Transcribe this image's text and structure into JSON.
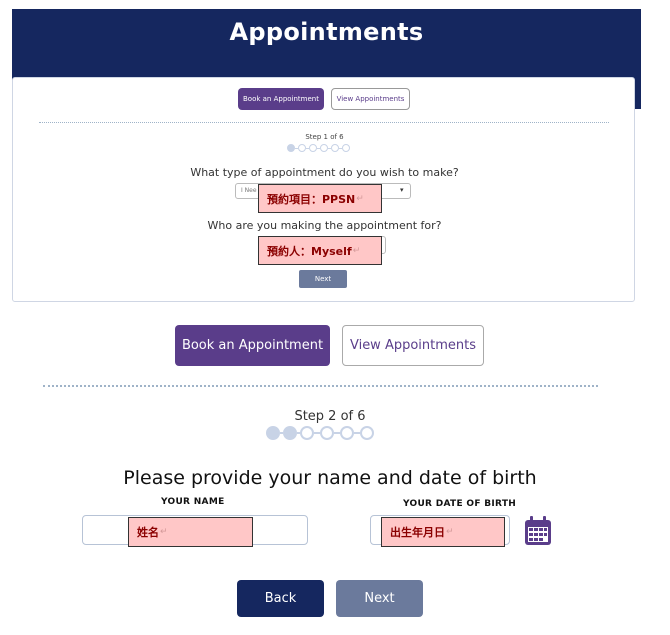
{
  "header": {
    "title": "Appointments"
  },
  "step1_screen": {
    "book_label": "Book an Appointment",
    "view_label": "View Appointments",
    "step_text": "Step 1 of 6",
    "current_step": 1,
    "total_steps": 6,
    "question1": "What type of appointment do you wish to make?",
    "select_value": "I Nee",
    "question2": "Who are you making the appointment for?",
    "next_label": "Next",
    "annotation_type": "預約項目：PPSN",
    "annotation_person": "預約人：Myself"
  },
  "step2_screen": {
    "book_label": "Book an Appointment",
    "view_label": "View Appointments",
    "step_text": "Step 2 of 6",
    "current_step": 2,
    "total_steps": 6,
    "prompt": "Please provide your name and date of birth",
    "name_label": "YOUR NAME",
    "dob_label": "YOUR DATE OF BIRTH",
    "annotation_name": "姓名",
    "annotation_dob": "出生年月日",
    "back_label": "Back",
    "next_label": "Next"
  },
  "icons": {
    "calendar": "calendar-icon",
    "return_mark": "↵"
  },
  "colors": {
    "header_navy": "#15275f",
    "accent_purple": "#5a3d8a",
    "muted_button": "#6b7a9c",
    "annotation_fill": "#ffc7c7",
    "annotation_text": "#8b0000"
  }
}
